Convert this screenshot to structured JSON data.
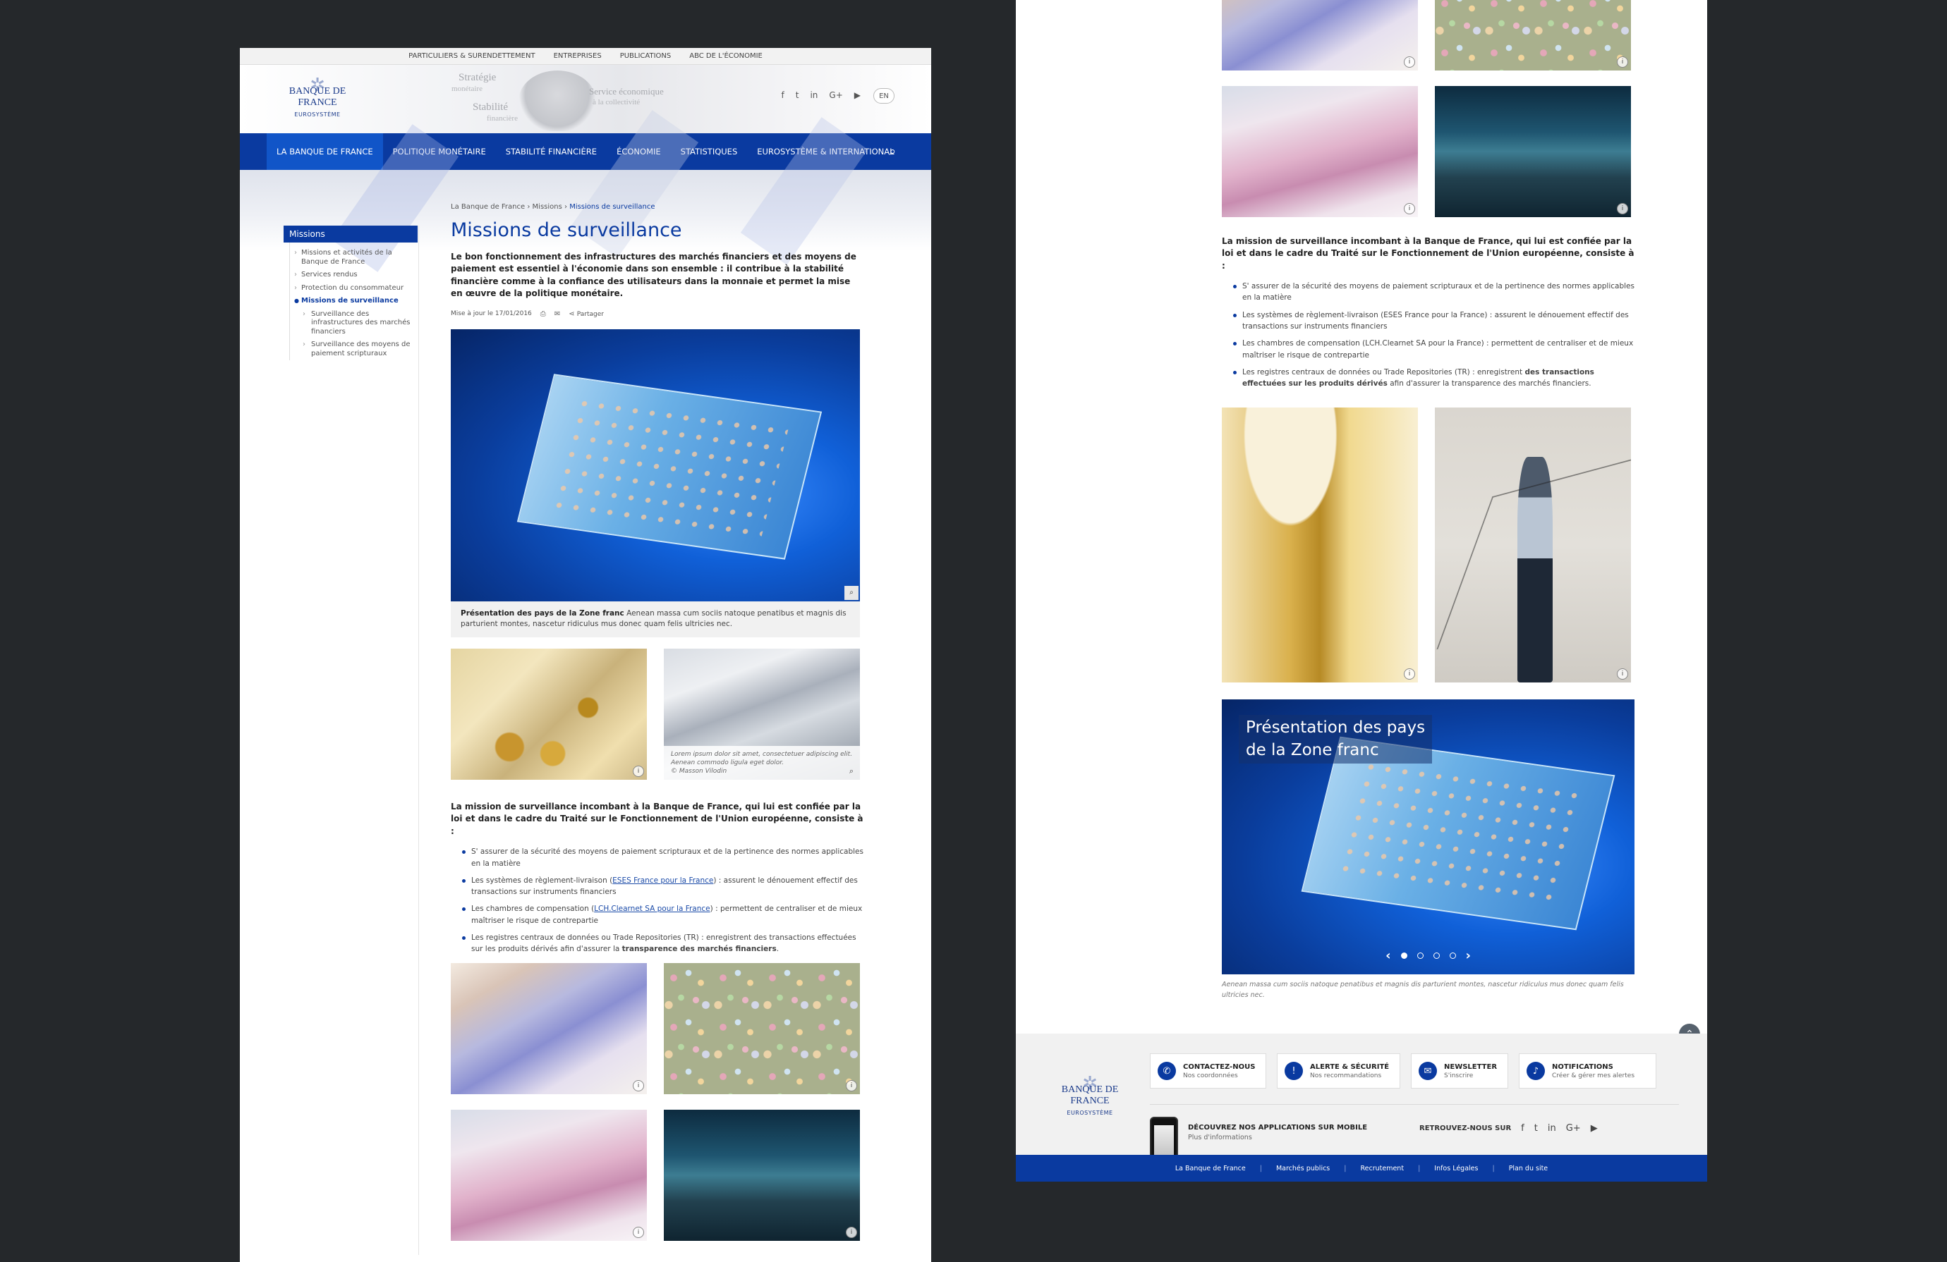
{
  "left": {
    "utility_links": [
      "PARTICULIERS & SURENDETTEMENT",
      "ENTREPRISES",
      "PUBLICATIONS",
      "ABC DE L'ÉCONOMIE"
    ],
    "logo": {
      "name": "BANQUE DE FRANCE",
      "sub": "EUROSYSTÈME"
    },
    "header_words": {
      "strategie": "Stratégie",
      "monetaire": "monétaire",
      "stabilite": "Stabilité",
      "financiere": "financière",
      "service": "Service économique",
      "collectivite": "à la collectivité"
    },
    "social": [
      "f",
      "t",
      "in",
      "G+",
      "▶"
    ],
    "lang": "EN",
    "nav": [
      "LA BANQUE DE FRANCE",
      "POLITIQUE MONÉTAIRE",
      "STABILITÉ FINANCIÈRE",
      "ÉCONOMIE",
      "STATISTIQUES",
      "EUROSYSTÈME & INTERNATIONAL"
    ],
    "sidebar": {
      "title": "Missions",
      "items": [
        "Missions et activités de la Banque de France",
        "Services rendus",
        "Protection du consommateur",
        "Missions de surveillance",
        "Surveillance des infrastructures des marchés financiers",
        "Surveillance des moyens de paiement scripturaux"
      ]
    },
    "breadcrumb": [
      "La Banque de France",
      "Missions",
      "Missions de surveillance"
    ],
    "title": "Missions de surveillance",
    "intro": "Le bon fonctionnement des infrastructures des marchés financiers et des moyens de paiement est essentiel à l'économie dans son ensemble : il contribue à la stabilité financière comme à la confiance des utilisateurs dans la monnaie et permet la mise en œuvre de la politique monétaire.",
    "meta": {
      "updated": "Mise à jour le 17/01/2016",
      "share": "Partager"
    },
    "hero_caption": {
      "title": "Présentation des pays de la Zone franc",
      "text": "Aenean massa cum sociis natoque penatibus et magnis dis parturient montes, nascetur ridiculus mus donec quam felis ultricies nec."
    },
    "tile_caption": {
      "text": "Lorem ipsum dolor sit amet, consectetuer adipiscing elit. Aenean commodo ligula eget dolor.",
      "credit": "© Masson Vilodin"
    },
    "mission_intro": "La mission de surveillance incombant à la Banque de France, qui lui est confiée par la loi et dans le cadre du Traité sur le Fonctionnement de l'Union européenne, consiste à :",
    "missions": [
      {
        "text": "S' assurer de la sécurité des moyens de paiement scripturaux et de la pertinence des normes applicables en la matière"
      },
      {
        "pre": "Les systèmes de règlement-livraison (",
        "link": "ESES France pour la France",
        "post": ") : assurent le dénouement effectif des transactions sur instruments financiers"
      },
      {
        "pre": "Les chambres de compensation (",
        "link": "LCH.Clearnet SA pour la France",
        "post": ") : permettent de centraliser et de mieux maîtriser le risque de contrepartie"
      },
      {
        "pre": "Les registres centraux de données ou Trade Repositories (TR) : enregistrent des transactions effectuées sur les produits dérivés afin d'assurer la ",
        "bold": "transparence des marchés financiers",
        "post": "."
      }
    ]
  },
  "right": {
    "mission_intro": "La mission de surveillance incombant à la Banque de France, qui lui est confiée par la loi et dans le cadre du Traité sur le Fonctionnement de l'Union européenne, consiste à :",
    "missions": [
      {
        "text": "S' assurer de la sécurité des moyens de paiement scripturaux et de la pertinence des normes applicables en la matière"
      },
      {
        "text": "Les systèmes de règlement-livraison (ESES France pour la France) : assurent le dénouement effectif des transactions sur instruments financiers"
      },
      {
        "text": "Les chambres de compensation (LCH.Clearnet SA pour la France) : permettent de centraliser et de mieux maîtriser le risque de contrepartie"
      },
      {
        "pre": "Les registres centraux de données ou Trade Repositories (TR) : enregistrent ",
        "bold": "des transactions effectuées sur les produits dérivés",
        "post": " afin d'assurer la transparence des marchés financiers."
      }
    ],
    "carousel": {
      "title_line1": "Présentation des pays",
      "title_line2": "de la Zone franc",
      "caption": "Aenean massa cum sociis natoque penatibus et magnis dis parturient montes, nascetur ridiculus mus donec quam felis ultricies nec."
    },
    "footer": {
      "logo": {
        "name": "BANQUE DE FRANCE",
        "sub": "EUROSYSTÈME"
      },
      "tiles": [
        {
          "title": "CONTACTEZ-NOUS",
          "sub": "Nos coordonnées"
        },
        {
          "title": "ALERTE & SÉCURITÉ",
          "sub": "Nos recommandations"
        },
        {
          "title": "NEWSLETTER",
          "sub": "S'inscrire"
        },
        {
          "title": "NOTIFICATIONS",
          "sub": "Créer & gérer mes alertes"
        }
      ],
      "apps": {
        "title": "DÉCOUVREZ NOS APPLICATIONS SUR MOBILE",
        "sub": "Plus d'informations"
      },
      "follow": "RETROUVEZ-NOUS SUR",
      "social": [
        "f",
        "t",
        "in",
        "G+",
        "▶"
      ],
      "bottom_links": [
        "La Banque de France",
        "Marchés publics",
        "Recrutement",
        "Infos Légales",
        "Plan du site"
      ]
    }
  },
  "colors": {
    "brand_blue": "#0a3aa0",
    "active_nav": "#1155c8"
  }
}
